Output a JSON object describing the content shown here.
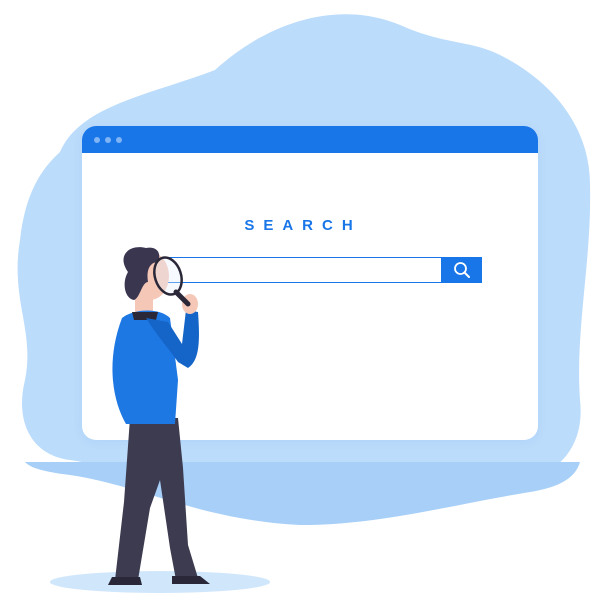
{
  "search": {
    "heading": "SEARCH",
    "input_value": "",
    "placeholder": ""
  },
  "colors": {
    "accent": "#1976e8",
    "blob": "#bcdcfb",
    "blob_shadow": "#a7cff8",
    "shirt": "#1e78e3",
    "pants": "#3d3b4f",
    "hair": "#3a3650",
    "skin": "#f5c7b6"
  },
  "icons": [
    "search-icon",
    "magnifying-glass-icon"
  ]
}
